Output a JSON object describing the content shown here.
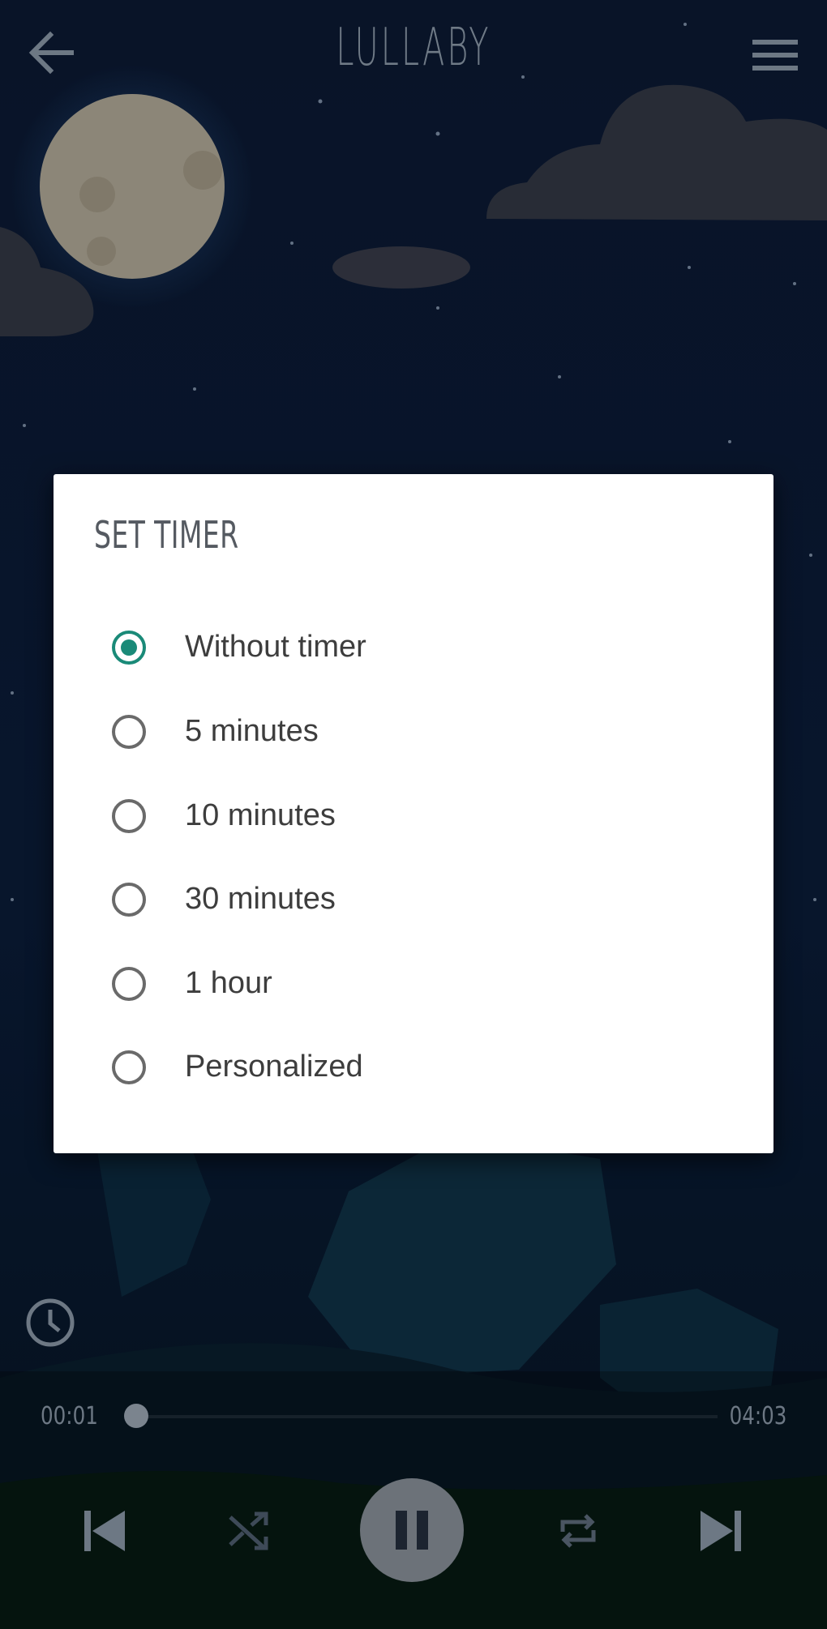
{
  "header": {
    "title": "LULLABY",
    "back_icon": "arrow-left-icon",
    "menu_icon": "hamburger-menu-icon"
  },
  "dialog": {
    "title": "SET TIMER",
    "selected": "Without timer",
    "options": [
      {
        "label": "Without timer",
        "checked": true
      },
      {
        "label": "5 minutes",
        "checked": false
      },
      {
        "label": "10 minutes",
        "checked": false
      },
      {
        "label": "30 minutes",
        "checked": false
      },
      {
        "label": "1 hour",
        "checked": false
      },
      {
        "label": "Personalized",
        "checked": false
      }
    ]
  },
  "player": {
    "current_time": "00:01",
    "total_time": "04:03",
    "progress_fraction": 0.004,
    "timer_icon": "clock-icon",
    "controls": [
      "skip-previous-icon",
      "shuffle-icon",
      "pause-icon",
      "repeat-icon",
      "skip-next-icon"
    ]
  },
  "colors": {
    "accent": "#1a8a78",
    "sky": "#0b1a33",
    "dialog_bg": "#ffffff",
    "icon_gray": "#6d7884"
  }
}
